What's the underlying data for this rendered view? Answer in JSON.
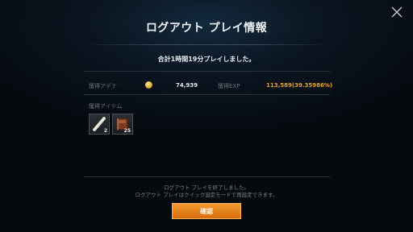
{
  "dialog": {
    "title": "ログアウト プレイ情報",
    "summary": "合計1時間19分プレイしました。"
  },
  "rewards": {
    "adena_label": "獲得アデナ",
    "adena_value": "74,939",
    "exp_label": "獲得EXP",
    "exp_value": "113,589(39.35986%)",
    "items_label": "獲得アイテム",
    "items": [
      {
        "icon": "scroll-icon",
        "count": "2"
      },
      {
        "icon": "book-icon",
        "count": "25"
      }
    ]
  },
  "notice": {
    "line1": "ログアウト プレイを終了しました。",
    "line2": "ログアウト プレイはクイック設定モードで再設定できます。"
  },
  "buttons": {
    "confirm_label": "確認"
  },
  "colors": {
    "exp_value": "#e8a22a",
    "confirm_button": "#e47a18"
  }
}
